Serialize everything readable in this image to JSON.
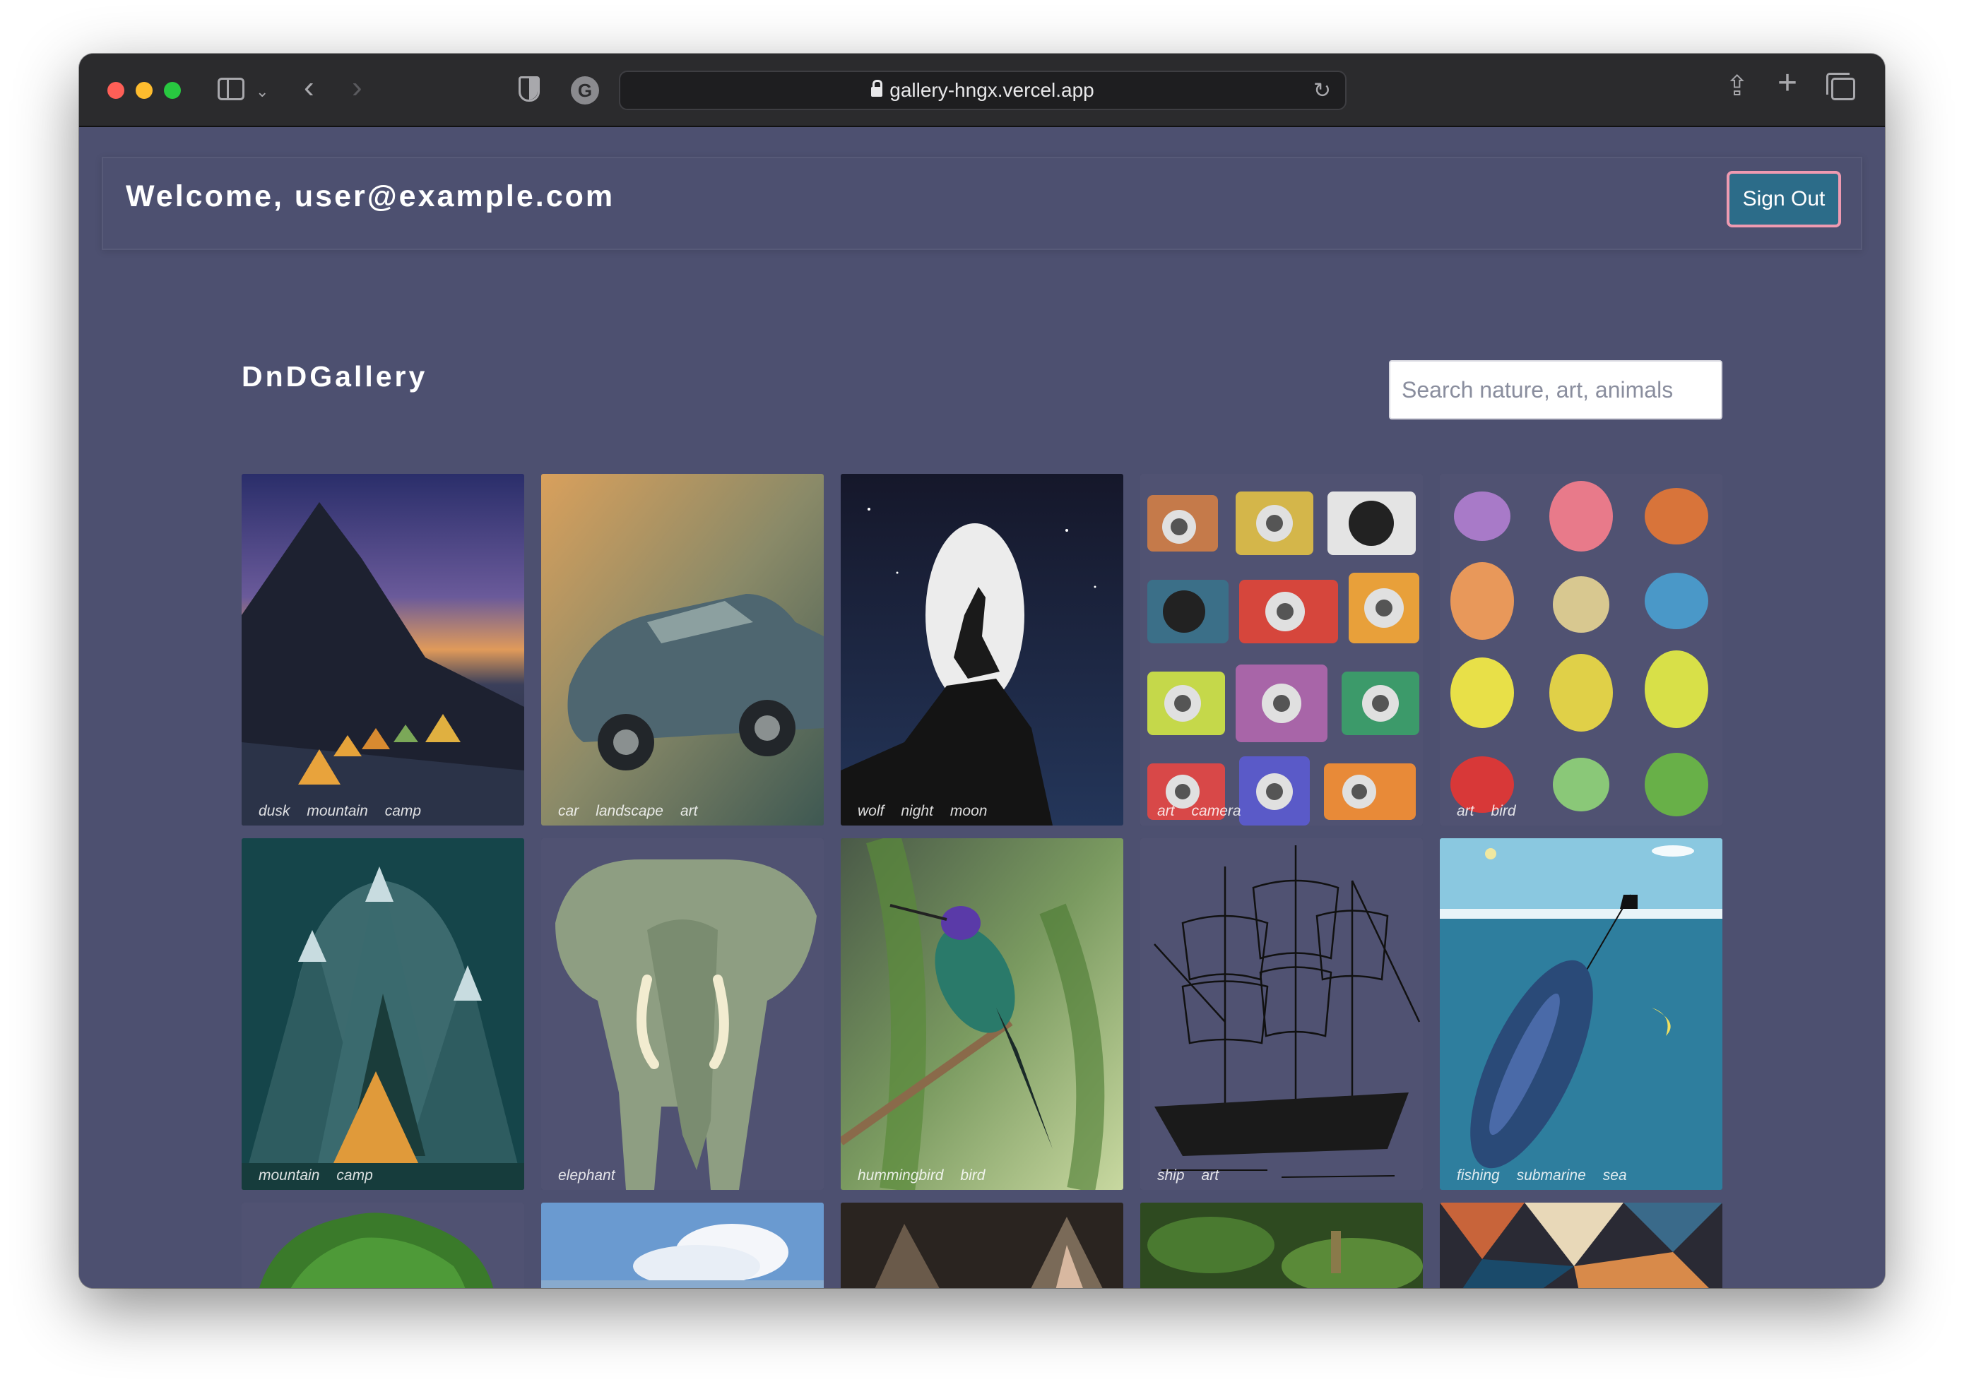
{
  "browser": {
    "url": "gallery-hngx.vercel.app"
  },
  "header": {
    "welcome": "Welcome, user@example.com",
    "sign_out_label": "Sign Out"
  },
  "gallery": {
    "title": "DnDGallery",
    "search_placeholder": "Search nature, art, animals",
    "cards": [
      {
        "tags": [
          "dusk",
          "mountain",
          "camp"
        ],
        "image": "tents-under-mountain-dusk"
      },
      {
        "tags": [
          "car",
          "landscape",
          "art"
        ],
        "image": "vintage-car"
      },
      {
        "tags": [
          "wolf",
          "night",
          "moon"
        ],
        "image": "wolf-howling-moon"
      },
      {
        "tags": [
          "art",
          "camera"
        ],
        "image": "cartoon-cameras"
      },
      {
        "tags": [
          "art",
          "bird"
        ],
        "image": "cartoon-birds"
      },
      {
        "tags": [
          "mountain",
          "camp"
        ],
        "image": "tent-mountains-illustration"
      },
      {
        "tags": [
          "elephant"
        ],
        "image": "elephant-illustration"
      },
      {
        "tags": [
          "hummingbird",
          "bird"
        ],
        "image": "hummingbird-on-branch"
      },
      {
        "tags": [
          "ship",
          "art"
        ],
        "image": "sailing-ship-sketch"
      },
      {
        "tags": [
          "fishing",
          "submarine",
          "sea"
        ],
        "image": "whale-submarine-illustration"
      },
      {
        "tags": [],
        "image": "tree"
      },
      {
        "tags": [],
        "image": "clouds-sky"
      },
      {
        "tags": [],
        "image": "cat"
      },
      {
        "tags": [],
        "image": "grass-field"
      },
      {
        "tags": [],
        "image": "abstract-painting"
      }
    ]
  }
}
